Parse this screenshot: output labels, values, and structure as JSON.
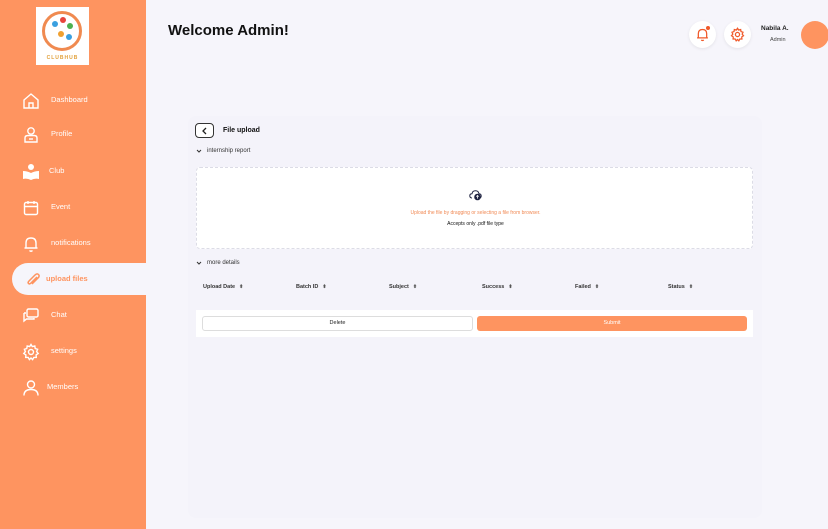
{
  "brand": {
    "logo_text": "CLUBHUB"
  },
  "sidebar": {
    "items": [
      {
        "label": "Dashboard",
        "icon": "home-icon"
      },
      {
        "label": "Profile",
        "icon": "profile-icon"
      },
      {
        "label": "Club",
        "icon": "club-icon"
      },
      {
        "label": "Event",
        "icon": "calendar-icon"
      },
      {
        "label": "notifications",
        "icon": "bell-icon"
      },
      {
        "label": "upload files",
        "icon": "paperclip-icon",
        "active": true
      },
      {
        "label": "Chat",
        "icon": "chat-icon"
      },
      {
        "label": "settings",
        "icon": "gear-icon"
      },
      {
        "label": "Members",
        "icon": "user-icon"
      }
    ]
  },
  "header": {
    "title": "Welcome Admin!",
    "user_name": "Nabila A.",
    "user_role": "Admin"
  },
  "upload": {
    "title": "File upload",
    "section_internship": "internship report",
    "dropzone_hint": "Upload the file by dragging or selecting a file from browser.",
    "dropzone_accept": "Accepts only .pdf file type",
    "section_more": "more details",
    "columns": [
      "Upload Date",
      "Batch ID",
      "Subject",
      "Success",
      "Failed",
      "Status"
    ],
    "delete_label": "Delete",
    "submit_label": "Submit"
  },
  "colors": {
    "accent": "#fe9460",
    "background": "#f6f5fb"
  }
}
